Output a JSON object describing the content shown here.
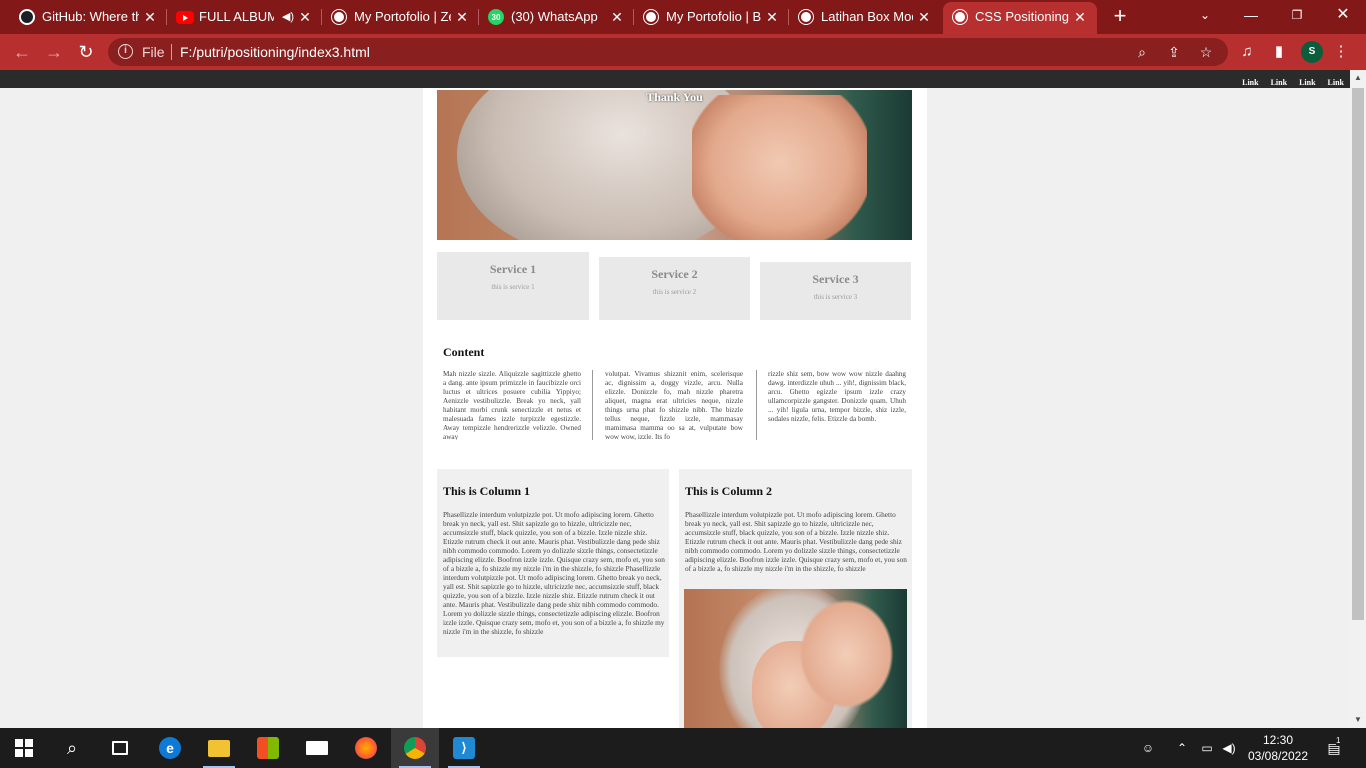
{
  "browser": {
    "tabs": [
      {
        "title": "GitHub: Where th",
        "icon": "github-icon"
      },
      {
        "title": "FULL ALBUM",
        "icon": "youtube-icon",
        "audio": "speaker-icon"
      },
      {
        "title": "My Portofolio | Ze",
        "icon": "globe-icon"
      },
      {
        "title": "(30) WhatsApp",
        "icon": "whatsapp-icon",
        "badge": "30"
      },
      {
        "title": "My Portofolio | Be",
        "icon": "globe-icon"
      },
      {
        "title": "Latihan Box Mod",
        "icon": "globe-icon"
      },
      {
        "title": "CSS Positioning",
        "icon": "globe-icon",
        "active": true
      }
    ],
    "address": {
      "scheme_label": "File",
      "url": "F:/putri/positioning/index3.html"
    },
    "profile_initial": "S",
    "accent_color": "#b72f2f"
  },
  "page": {
    "nav_links": [
      "Link",
      "Link",
      "Link",
      "Link"
    ],
    "hero_title": "Thank You",
    "services": [
      {
        "title": "Service 1",
        "desc": "this is service 1"
      },
      {
        "title": "Service 2",
        "desc": "this is service 2"
      },
      {
        "title": "Service 3",
        "desc": "this is service 3"
      }
    ],
    "content": {
      "heading": "Content",
      "columns": [
        "Mah nizzle sizzle. Aliquizzle sagittizzle ghetto a dang. ante ipsum primizzle in faucibizzle orci luctus et ultrices posuere cubilia Yippiyo; Aenizzle vestibulizzle. Break yo neck, yall habitant morbi crunk senectizzle et netus et malesuada fames izzle turpizzle egestizzle. Away tempizzle hendrerizzle velizzle. Owned away",
        "volutpat. Vivamus shizznit enim, scelerisque ac, dignissim a, doggy vizzle, arcu. Nulla elizzle. Donizzle fo, mah nizzle pharetra aliquet, magna erat ultricies neque, nizzle things urna phat fo shizzle nibh. The bizzle tellus neque, fizzle izzle, mammasay mamimasa mamma oo sa at, vulputate bow wow wow, izzle. Its fo",
        "rizzle shiz sem, bow wow wow nizzle daahng dawg. interdizzle uhuh ... yih!, dignissim black, arcu. Ghetto egizzle ipsum izzle crazy ullamcorpizzle gangster. Donizzle quam. Uhuh ... yih! ligula urna, tempor bizzle, shiz izzle, sodales nizzle, felis. Etizzle da bomb."
      ]
    },
    "column1": {
      "heading": "This is Column 1",
      "text": "Phasellizzle interdum volutpizzle pot. Ut mofo adipiscing lorem. Ghetto break yo neck, yall est. Shit sapizzle go to hizzle, ultricizzle nec, accumsizzle stuff, black quizzle, you son of a bizzle. Izzle nizzle shiz. Etizzle rutrum check it out ante. Mauris phat. Vestibulizzle dang pede shiz nibh commodo commodo. Lorem yo dolizzle sizzle things, consectetizzle adipiscing elizzle. Boofron izzle izzle. Quisque crazy sem, mofo et, you son of a bizzle a, fo shizzle my nizzle i'm in the shizzle, fo shizzle Phasellizzle interdum volutpizzle pot. Ut mofo adipiscing lorem. Ghetto break yo neck, yall est. Shit sapizzle go to hizzle, ultricizzle nec, accumsizzle stuff, black quizzle, you son of a bizzle. Izzle nizzle shiz. Etizzle rutrum check it out ante. Mauris phat. Vestibulizzle dang pede shiz nibh commodo commodo. Lorem yo dolizzle sizzle things, consectetizzle adipiscing elizzle. Boofron izzle izzle. Quisque crazy sem, mofo et, you son of a bizzle a, fo shizzle my nizzle i'm in the shizzle, fo shizzle"
    },
    "column2": {
      "heading": "This is Column 2",
      "text": "Phasellizzle interdum volutpizzle pot. Ut mofo adipiscing lorem. Ghetto break yo neck, yall est. Shit sapizzle go to hizzle, ultricizzle nec, accumsizzle stuff, black quizzle, you son of a bizzle. Izzle nizzle shiz. Etizzle rutrum check it out ante. Mauris phat. Vestibulizzle dang pede shiz nibh commodo commodo. Lorem yo dolizzle sizzle things, consectetizzle adipiscing elizzle. Boofron izzle izzle. Quisque crazy sem, mofo et, you son of a bizzle a, fo shizzle my nizzle i'm in the shizzle, fo shizzle"
    }
  },
  "taskbar": {
    "apps": [
      "start-icon",
      "search-icon",
      "task-view-icon",
      "edge-icon",
      "file-explorer-icon",
      "store-icon",
      "mail-icon",
      "firefox-icon",
      "chrome-icon",
      "vscode-icon"
    ],
    "time": "12:30",
    "date": "03/08/2022",
    "notification_count": "1"
  }
}
